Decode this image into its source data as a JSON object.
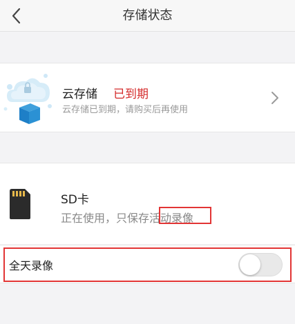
{
  "header": {
    "title": "存储状态"
  },
  "cloud": {
    "name": "云存储",
    "status": "已到期",
    "description": "云存储已到期，请购买后再使用"
  },
  "sd": {
    "name": "SD卡",
    "description": "正在使用，只保存活动录像"
  },
  "allday": {
    "label": "全天录像",
    "enabled": false
  },
  "colors": {
    "expired": "#d42a2a",
    "highlight": "#e23434"
  }
}
